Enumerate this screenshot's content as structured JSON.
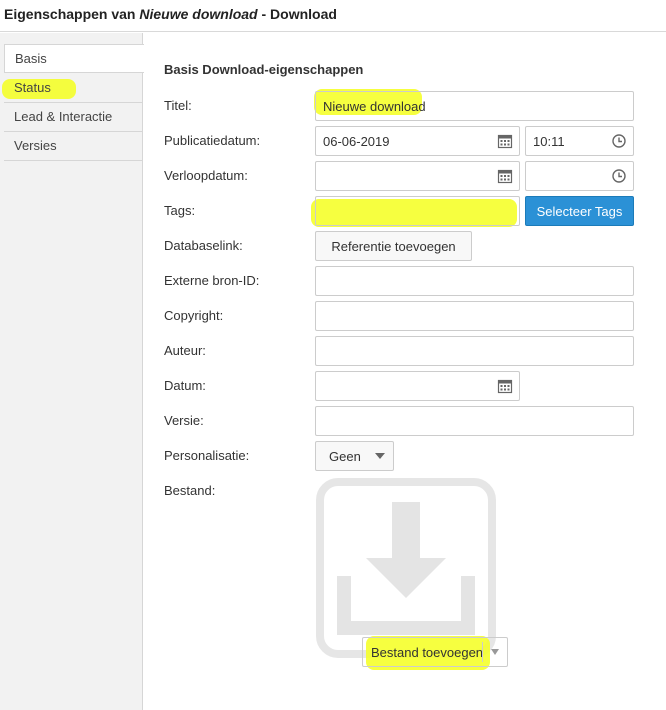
{
  "window": {
    "title_prefix": "Eigenschappen van ",
    "title_italic": "Nieuwe download",
    "title_suffix": " - Download"
  },
  "sidebar": {
    "tabs": [
      {
        "label": "Basis",
        "active": true
      },
      {
        "label": "Status",
        "active": false
      },
      {
        "label": "Lead & Interactie",
        "active": false
      },
      {
        "label": "Versies",
        "active": false
      }
    ]
  },
  "form": {
    "section_title": "Basis Download-eigenschappen",
    "titel": {
      "label": "Titel:",
      "value": "Nieuwe download"
    },
    "publicatiedatum": {
      "label": "Publicatiedatum:",
      "date": "06-06-2019",
      "time": "10:11"
    },
    "verloopdatum": {
      "label": "Verloopdatum:",
      "date": "",
      "time": ""
    },
    "tags": {
      "label": "Tags:",
      "value": "",
      "button": "Selecteer Tags"
    },
    "databaselink": {
      "label": "Databaselink:",
      "button": "Referentie toevoegen"
    },
    "externe_bron": {
      "label": "Externe bron-ID:",
      "value": ""
    },
    "copyright": {
      "label": "Copyright:",
      "value": ""
    },
    "auteur": {
      "label": "Auteur:",
      "value": ""
    },
    "datum": {
      "label": "Datum:",
      "value": ""
    },
    "versie": {
      "label": "Versie:",
      "value": ""
    },
    "personalisatie": {
      "label": "Personalisatie:",
      "selected": "Geen"
    },
    "bestand": {
      "label": "Bestand:",
      "button": "Bestand toevoegen"
    }
  },
  "colors": {
    "accent": "#2b91d6",
    "highlight": "#f5ff1e"
  },
  "icons": [
    "calendar-icon",
    "clock-icon",
    "download-tray-icon",
    "chevron-down-icon"
  ]
}
